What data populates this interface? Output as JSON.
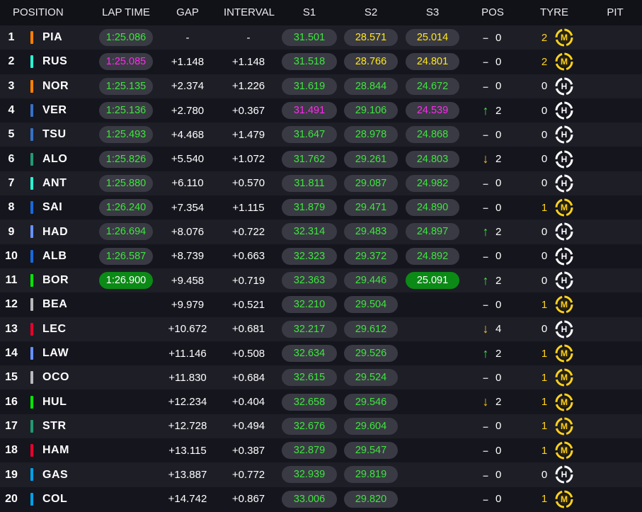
{
  "columns": {
    "position": "POSITION",
    "lap_time": "LAP TIME",
    "gap": "GAP",
    "interval": "INTERVAL",
    "s1": "S1",
    "s2": "S2",
    "s3": "S3",
    "pos": "POS",
    "tyre": "TYRE",
    "pit": "PIT"
  },
  "colors": {
    "green": "#3ce63c",
    "yellow": "#ffe81a",
    "purple": "#ff2bf0",
    "medium_tyre": "#ffd21a",
    "hard_tyre": "#ffffff"
  },
  "rows": [
    {
      "pos": "1",
      "driver": "PIA",
      "team_color": "#ff8000",
      "lap": "1:25.086",
      "lap_style": "green",
      "gap": "-",
      "interval": "-",
      "s1": "31.501",
      "s1_style": "green",
      "s2": "28.571",
      "s2_style": "yellow",
      "s3": "25.014",
      "s3_style": "yellow",
      "pos_change": "dash",
      "pos_value": "0",
      "tyre_laps": "2",
      "tyre": "M"
    },
    {
      "pos": "2",
      "driver": "RUS",
      "team_color": "#27f4d2",
      "lap": "1:25.085",
      "lap_style": "purple",
      "gap": "+1.148",
      "interval": "+1.148",
      "s1": "31.518",
      "s1_style": "green",
      "s2": "28.766",
      "s2_style": "yellow",
      "s3": "24.801",
      "s3_style": "yellow",
      "pos_change": "dash",
      "pos_value": "0",
      "tyre_laps": "2",
      "tyre": "M"
    },
    {
      "pos": "3",
      "driver": "NOR",
      "team_color": "#ff8000",
      "lap": "1:25.135",
      "lap_style": "green",
      "gap": "+2.374",
      "interval": "+1.226",
      "s1": "31.619",
      "s1_style": "green",
      "s2": "28.844",
      "s2_style": "green",
      "s3": "24.672",
      "s3_style": "green",
      "pos_change": "dash",
      "pos_value": "0",
      "tyre_laps": "0",
      "tyre": "H"
    },
    {
      "pos": "4",
      "driver": "VER",
      "team_color": "#3671c6",
      "lap": "1:25.136",
      "lap_style": "green",
      "gap": "+2.780",
      "interval": "+0.367",
      "s1": "31.491",
      "s1_style": "purple",
      "s2": "29.106",
      "s2_style": "green",
      "s3": "24.539",
      "s3_style": "purple",
      "pos_change": "up",
      "pos_value": "2",
      "tyre_laps": "0",
      "tyre": "H"
    },
    {
      "pos": "5",
      "driver": "TSU",
      "team_color": "#3671c6",
      "lap": "1:25.493",
      "lap_style": "green",
      "gap": "+4.468",
      "interval": "+1.479",
      "s1": "31.647",
      "s1_style": "green",
      "s2": "28.978",
      "s2_style": "green",
      "s3": "24.868",
      "s3_style": "green",
      "pos_change": "dash",
      "pos_value": "0",
      "tyre_laps": "0",
      "tyre": "H"
    },
    {
      "pos": "6",
      "driver": "ALO",
      "team_color": "#229971",
      "lap": "1:25.826",
      "lap_style": "green",
      "gap": "+5.540",
      "interval": "+1.072",
      "s1": "31.762",
      "s1_style": "green",
      "s2": "29.261",
      "s2_style": "green",
      "s3": "24.803",
      "s3_style": "green",
      "pos_change": "down",
      "pos_value": "2",
      "tyre_laps": "0",
      "tyre": "H"
    },
    {
      "pos": "7",
      "driver": "ANT",
      "team_color": "#27f4d2",
      "lap": "1:25.880",
      "lap_style": "green",
      "gap": "+6.110",
      "interval": "+0.570",
      "s1": "31.811",
      "s1_style": "green",
      "s2": "29.087",
      "s2_style": "green",
      "s3": "24.982",
      "s3_style": "green",
      "pos_change": "dash",
      "pos_value": "0",
      "tyre_laps": "0",
      "tyre": "H"
    },
    {
      "pos": "8",
      "driver": "SAI",
      "team_color": "#1868db",
      "lap": "1:26.240",
      "lap_style": "green",
      "gap": "+7.354",
      "interval": "+1.115",
      "s1": "31.879",
      "s1_style": "green",
      "s2": "29.471",
      "s2_style": "green",
      "s3": "24.890",
      "s3_style": "green",
      "pos_change": "dash",
      "pos_value": "0",
      "tyre_laps": "1",
      "tyre": "M"
    },
    {
      "pos": "9",
      "driver": "HAD",
      "team_color": "#6692ff",
      "lap": "1:26.694",
      "lap_style": "green",
      "gap": "+8.076",
      "interval": "+0.722",
      "s1": "32.314",
      "s1_style": "green",
      "s2": "29.483",
      "s2_style": "green",
      "s3": "24.897",
      "s3_style": "green",
      "pos_change": "up",
      "pos_value": "2",
      "tyre_laps": "0",
      "tyre": "H"
    },
    {
      "pos": "10",
      "driver": "ALB",
      "team_color": "#1868db",
      "lap": "1:26.587",
      "lap_style": "green",
      "gap": "+8.739",
      "interval": "+0.663",
      "s1": "32.323",
      "s1_style": "green",
      "s2": "29.372",
      "s2_style": "green",
      "s3": "24.892",
      "s3_style": "green",
      "pos_change": "dash",
      "pos_value": "0",
      "tyre_laps": "0",
      "tyre": "H"
    },
    {
      "pos": "11",
      "driver": "BOR",
      "team_color": "#00e700",
      "lap": "1:26.900",
      "lap_style": "solid",
      "gap": "+9.458",
      "interval": "+0.719",
      "s1": "32.363",
      "s1_style": "green",
      "s2": "29.446",
      "s2_style": "green",
      "s3": "25.091",
      "s3_style": "solid",
      "pos_change": "up",
      "pos_value": "2",
      "tyre_laps": "0",
      "tyre": "H"
    },
    {
      "pos": "12",
      "driver": "BEA",
      "team_color": "#b6babd",
      "lap": "",
      "lap_style": "none",
      "gap": "+9.979",
      "interval": "+0.521",
      "s1": "32.210",
      "s1_style": "green",
      "s2": "29.504",
      "s2_style": "green",
      "s3": "",
      "s3_style": "none",
      "pos_change": "dash",
      "pos_value": "0",
      "tyre_laps": "1",
      "tyre": "M"
    },
    {
      "pos": "13",
      "driver": "LEC",
      "team_color": "#e8002d",
      "lap": "",
      "lap_style": "none",
      "gap": "+10.672",
      "interval": "+0.681",
      "s1": "32.217",
      "s1_style": "green",
      "s2": "29.612",
      "s2_style": "green",
      "s3": "",
      "s3_style": "none",
      "pos_change": "down",
      "pos_value": "4",
      "tyre_laps": "0",
      "tyre": "H"
    },
    {
      "pos": "14",
      "driver": "LAW",
      "team_color": "#6692ff",
      "lap": "",
      "lap_style": "none",
      "gap": "+11.146",
      "interval": "+0.508",
      "s1": "32.634",
      "s1_style": "green",
      "s2": "29.526",
      "s2_style": "green",
      "s3": "",
      "s3_style": "none",
      "pos_change": "up",
      "pos_value": "2",
      "tyre_laps": "1",
      "tyre": "M"
    },
    {
      "pos": "15",
      "driver": "OCO",
      "team_color": "#b6babd",
      "lap": "",
      "lap_style": "none",
      "gap": "+11.830",
      "interval": "+0.684",
      "s1": "32.615",
      "s1_style": "green",
      "s2": "29.524",
      "s2_style": "green",
      "s3": "",
      "s3_style": "none",
      "pos_change": "dash",
      "pos_value": "0",
      "tyre_laps": "1",
      "tyre": "M"
    },
    {
      "pos": "16",
      "driver": "HUL",
      "team_color": "#00e700",
      "lap": "",
      "lap_style": "none",
      "gap": "+12.234",
      "interval": "+0.404",
      "s1": "32.658",
      "s1_style": "green",
      "s2": "29.546",
      "s2_style": "green",
      "s3": "",
      "s3_style": "none",
      "pos_change": "down",
      "pos_value": "2",
      "tyre_laps": "1",
      "tyre": "M"
    },
    {
      "pos": "17",
      "driver": "STR",
      "team_color": "#229971",
      "lap": "",
      "lap_style": "none",
      "gap": "+12.728",
      "interval": "+0.494",
      "s1": "32.676",
      "s1_style": "green",
      "s2": "29.604",
      "s2_style": "green",
      "s3": "",
      "s3_style": "none",
      "pos_change": "dash",
      "pos_value": "0",
      "tyre_laps": "1",
      "tyre": "M"
    },
    {
      "pos": "18",
      "driver": "HAM",
      "team_color": "#e8002d",
      "lap": "",
      "lap_style": "none",
      "gap": "+13.115",
      "interval": "+0.387",
      "s1": "32.879",
      "s1_style": "green",
      "s2": "29.547",
      "s2_style": "green",
      "s3": "",
      "s3_style": "none",
      "pos_change": "dash",
      "pos_value": "0",
      "tyre_laps": "1",
      "tyre": "M"
    },
    {
      "pos": "19",
      "driver": "GAS",
      "team_color": "#00a1e8",
      "lap": "",
      "lap_style": "none",
      "gap": "+13.887",
      "interval": "+0.772",
      "s1": "32.939",
      "s1_style": "green",
      "s2": "29.819",
      "s2_style": "green",
      "s3": "",
      "s3_style": "none",
      "pos_change": "dash",
      "pos_value": "0",
      "tyre_laps": "0",
      "tyre": "H"
    },
    {
      "pos": "20",
      "driver": "COL",
      "team_color": "#00a1e8",
      "lap": "",
      "lap_style": "none",
      "gap": "+14.742",
      "interval": "+0.867",
      "s1": "33.006",
      "s1_style": "green",
      "s2": "29.820",
      "s2_style": "green",
      "s3": "",
      "s3_style": "none",
      "pos_change": "dash",
      "pos_value": "0",
      "tyre_laps": "1",
      "tyre": "M"
    }
  ]
}
